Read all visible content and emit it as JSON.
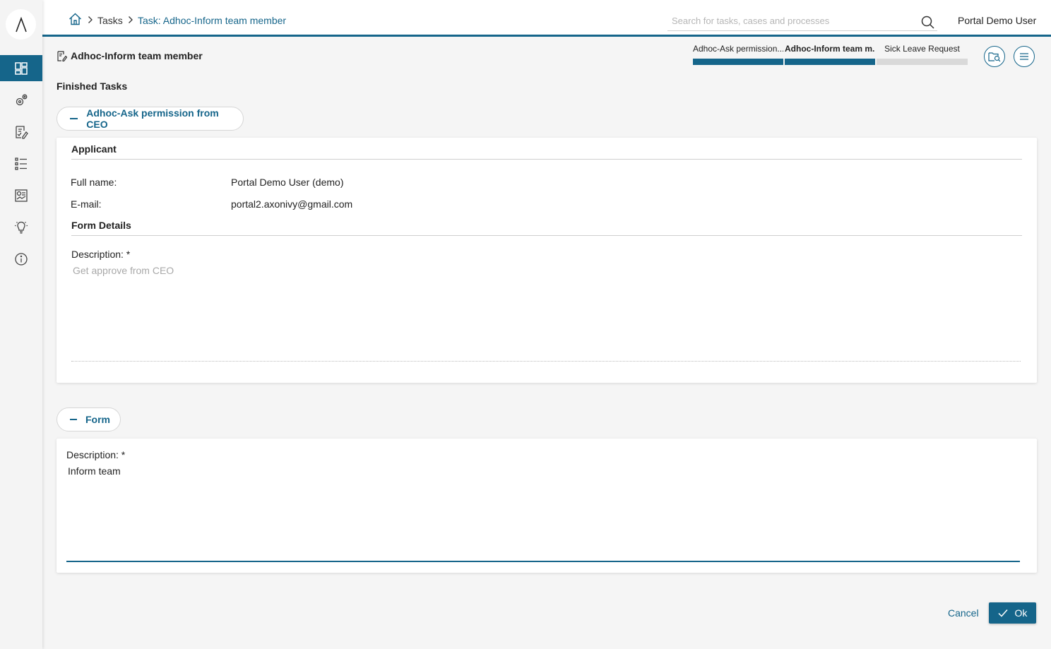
{
  "colors": {
    "primary": "#15658a",
    "step_done": "#15658a",
    "step_pending": "#d9d9d9",
    "sidebar_bg": "#f4f4f4"
  },
  "sidebar": {
    "logo_icon": "axon-ivy-logo",
    "items": [
      {
        "icon": "dashboard-icon",
        "active": true
      },
      {
        "icon": "processes-gear-icon",
        "active": false
      },
      {
        "icon": "tasks-icon",
        "active": false
      },
      {
        "icon": "cases-list-icon",
        "active": false
      },
      {
        "icon": "statistics-icon",
        "active": false
      },
      {
        "icon": "lightbulb-icon",
        "active": false
      },
      {
        "icon": "info-icon",
        "active": false
      }
    ]
  },
  "header": {
    "breadcrumb": {
      "home_icon": "home-icon",
      "tasks": "Tasks",
      "current": "Task: Adhoc-Inform team member"
    },
    "search": {
      "placeholder": "Search for tasks, cases and processes",
      "value": ""
    },
    "user_name": "Portal Demo User"
  },
  "task": {
    "title": "Adhoc-Inform team member",
    "steps": [
      {
        "label": "Adhoc-Ask permission...",
        "state": "done"
      },
      {
        "label": "Adhoc-Inform team m...",
        "state": "current"
      },
      {
        "label": "Sick Leave Request",
        "state": "pending"
      }
    ],
    "actions": {
      "case_details_icon": "case-details-icon",
      "menu_icon": "menu-icon"
    }
  },
  "finished_tasks": {
    "heading": "Finished Tasks",
    "panel_toggle_label": "Adhoc-Ask permission from CEO",
    "applicant": {
      "heading": "Applicant",
      "full_name_label": "Full name:",
      "full_name_value": "Portal Demo User (demo)",
      "email_label": "E-mail:",
      "email_value": "portal2.axonivy@gmail.com"
    },
    "form_details": {
      "heading": "Form Details",
      "description_label": "Description:  *",
      "description_value": "Get approve from CEO"
    }
  },
  "form": {
    "panel_toggle_label": "Form",
    "description_label": "Description:  *",
    "description_value": "Inform team"
  },
  "footer": {
    "cancel_label": "Cancel",
    "ok_label": "Ok"
  }
}
